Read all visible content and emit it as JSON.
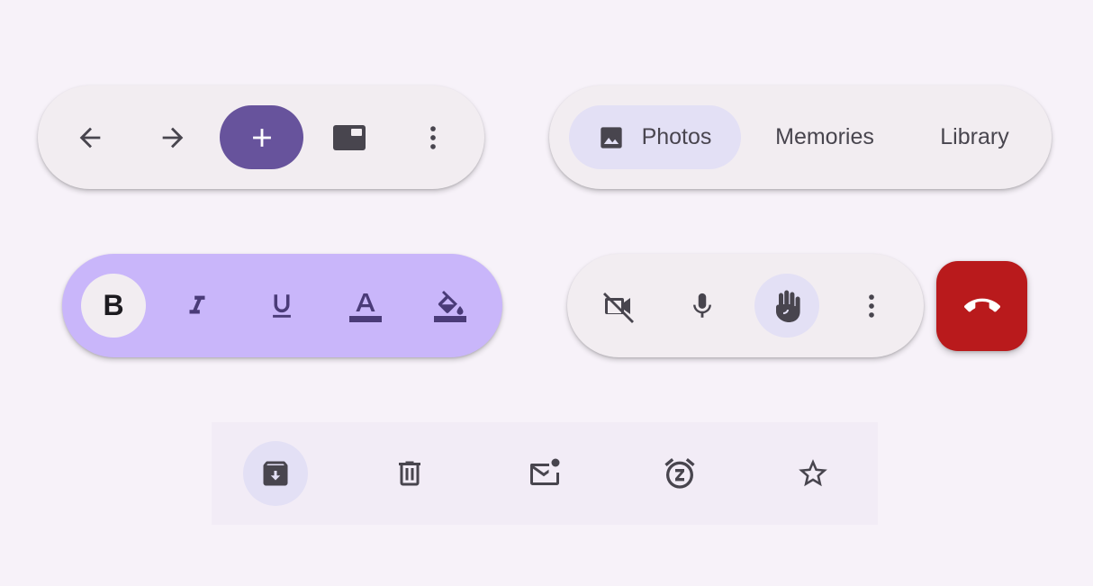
{
  "nav_toolbar": {
    "icons": [
      "arrow-back-icon",
      "arrow-forward-icon",
      "add-icon",
      "picture-in-picture-icon",
      "more-vert-icon"
    ],
    "accent": "#67539c"
  },
  "tabs_toolbar": {
    "tabs": [
      {
        "label": "Photos",
        "icon": "image-icon",
        "selected": true
      },
      {
        "label": "Memories",
        "selected": false
      },
      {
        "label": "Library",
        "selected": false
      }
    ],
    "selected_bg": "#e3e0f5"
  },
  "format_toolbar": {
    "bold_label": "B",
    "icons": [
      "format-bold-icon",
      "format-italic-icon",
      "format-underline-icon",
      "format-color-text-icon",
      "format-color-fill-icon"
    ],
    "background": "#c9b6fa"
  },
  "call_toolbar": {
    "icons": [
      "videocam-off-icon",
      "mic-icon",
      "raise-hand-icon",
      "more-vert-icon"
    ],
    "hangup_icon": "call-end-icon",
    "hangup_color": "#b91a1c"
  },
  "mail_toolbar": {
    "icons": [
      "archive-icon",
      "delete-icon",
      "mark-unread-icon",
      "snooze-icon",
      "star-icon"
    ],
    "selected_index": 0
  }
}
